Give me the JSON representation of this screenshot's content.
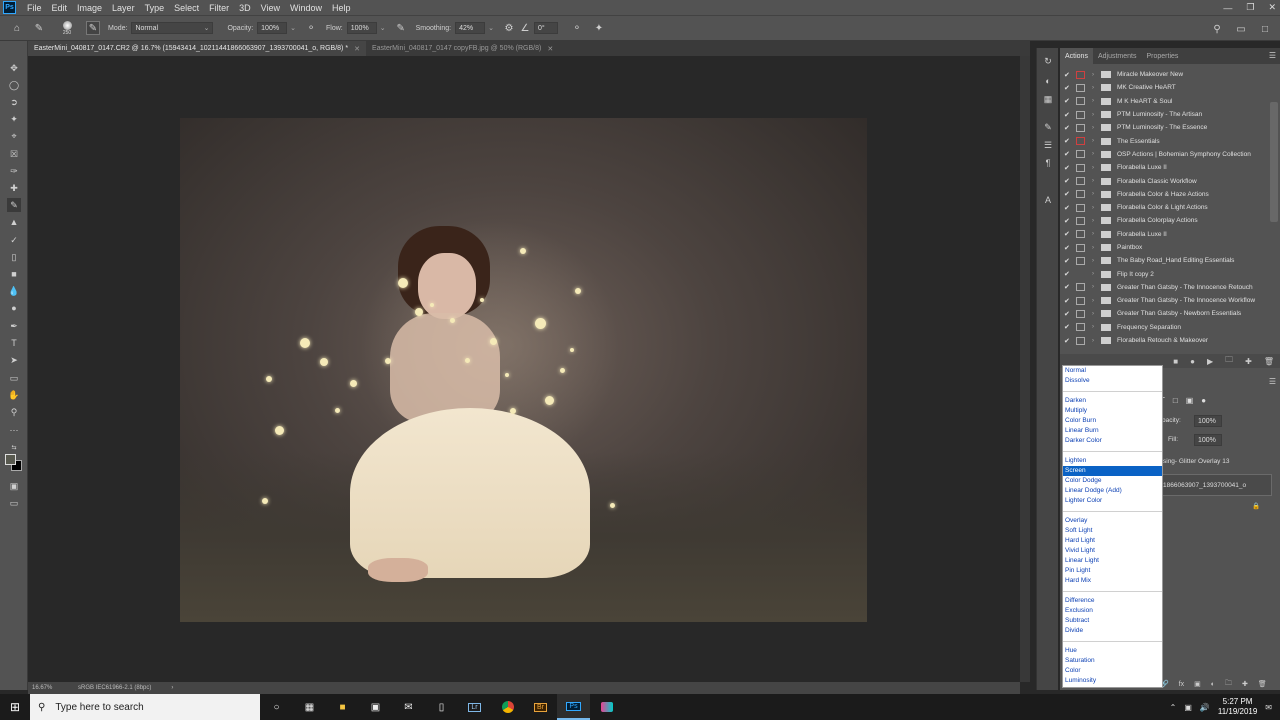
{
  "app": {
    "logo": "Ps"
  },
  "menu": [
    "File",
    "Edit",
    "Image",
    "Layer",
    "Type",
    "Select",
    "Filter",
    "3D",
    "View",
    "Window",
    "Help"
  ],
  "options": {
    "brush_size": "250",
    "mode_label": "Mode:",
    "mode_value": "Normal",
    "opacity_label": "Opacity:",
    "opacity_value": "100%",
    "flow_label": "Flow:",
    "flow_value": "100%",
    "smoothing_label": "Smoothing:",
    "smoothing_value": "42%",
    "angle_value": "0°"
  },
  "tabs": [
    {
      "label": "EasterMini_040817_0147.CR2 @ 16.7% (15943414_10211441866063907_1393700041_o, RGB/8) *",
      "active": true
    },
    {
      "label": "EasterMini_040817_0147 copyFB.jpg @ 50% (RGB/8)",
      "active": false
    }
  ],
  "status": {
    "zoom": "16.67%",
    "profile": "sRGB IEC61966-2.1 (8bpc)"
  },
  "panel": {
    "tabs": [
      "Actions",
      "Adjustments",
      "Properties"
    ],
    "actions": [
      {
        "label": "Miracle Makeover New",
        "dialog": "red"
      },
      {
        "label": "MK Creative HeART",
        "dialog": ""
      },
      {
        "label": "M K HeART & Soul",
        "dialog": ""
      },
      {
        "label": "PTM Luminosity - The Artisan",
        "dialog": ""
      },
      {
        "label": "PTM Luminosity - The Essence",
        "dialog": ""
      },
      {
        "label": "The Essentials",
        "dialog": "red"
      },
      {
        "label": "OSP Actions | Bohemian Symphony Collection",
        "dialog": ""
      },
      {
        "label": "Florabella Luxe II",
        "dialog": ""
      },
      {
        "label": "Florabella Classic Workflow",
        "dialog": ""
      },
      {
        "label": "Florabella Color & Haze Actions",
        "dialog": ""
      },
      {
        "label": "Florabella Color & Light Actions",
        "dialog": ""
      },
      {
        "label": "Florabella Colorplay Actions",
        "dialog": ""
      },
      {
        "label": "Florabella Luxe II",
        "dialog": ""
      },
      {
        "label": "Paintbox",
        "dialog": ""
      },
      {
        "label": "The Baby Road_Hand Editing Essentials",
        "dialog": ""
      },
      {
        "label": "Flip It copy 2",
        "dialog": "none"
      },
      {
        "label": "Greater Than Gatsby - The Innocence Retouch",
        "dialog": ""
      },
      {
        "label": "Greater Than Gatsby - The Innocence Workflow",
        "dialog": ""
      },
      {
        "label": "Greater Than Gatsby - Newborn Essentials",
        "dialog": ""
      },
      {
        "label": "Frequency Separation",
        "dialog": ""
      },
      {
        "label": "Florabella Retouch & Makeover",
        "dialog": ""
      }
    ]
  },
  "layers": {
    "opacity_label": "pacity:",
    "opacity_value": "100%",
    "fill_label": "Fill:",
    "fill_value": "100%",
    "layer1": "sing- Glitter Overlay 13",
    "layer2": "1866063907_1393700041_o"
  },
  "blend_modes": [
    [
      "Normal",
      "Dissolve"
    ],
    [
      "Darken",
      "Multiply",
      "Color Burn",
      "Linear Burn",
      "Darker Color"
    ],
    [
      "Lighten",
      "Screen",
      "Color Dodge",
      "Linear Dodge (Add)",
      "Lighter Color"
    ],
    [
      "Overlay",
      "Soft Light",
      "Hard Light",
      "Vivid Light",
      "Linear Light",
      "Pin Light",
      "Hard Mix"
    ],
    [
      "Difference",
      "Exclusion",
      "Subtract",
      "Divide"
    ],
    [
      "Hue",
      "Saturation",
      "Color",
      "Luminosity"
    ]
  ],
  "blend_selected": "Screen",
  "taskbar": {
    "search_placeholder": "Type here to search",
    "time": "5:27 PM",
    "date": "11/19/2019",
    "apps": [
      "Lr",
      "Br",
      "Ps"
    ]
  }
}
